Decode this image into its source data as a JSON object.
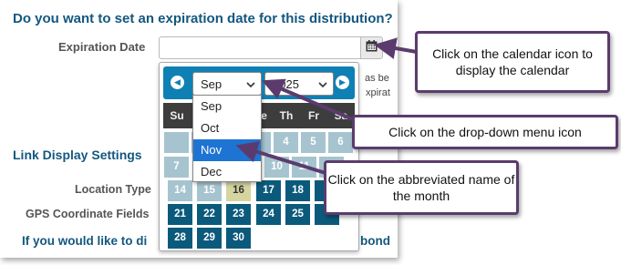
{
  "form": {
    "heading": "Do you want to set an expiration date for this distribution?",
    "expiration_label": "Expiration Date",
    "expiration_value": "",
    "behind_text_1": "as be",
    "behind_text_2": "xpirat",
    "section_title": "Link Display Settings",
    "location_type_label": "Location Type",
    "gps_label": "GPS Coordinate Fields",
    "bottom_text_left": "If you would like to di",
    "bottom_text_right": "bond"
  },
  "datepicker": {
    "month_selected": "Sep",
    "year_selected": "2025",
    "prev_icon": "chevron-left-icon",
    "next_icon": "chevron-right-icon",
    "weekdays": [
      "Su",
      "Mo",
      "Tu",
      "We",
      "Th",
      "Fr",
      "Sa"
    ],
    "row2_days": [
      "7",
      "",
      "",
      "10",
      "11",
      "12",
      ""
    ],
    "row1_days": [
      "",
      "",
      "",
      "3",
      "4",
      "5",
      "6"
    ],
    "row3_days": [
      "14",
      "15",
      "16",
      "17",
      "18",
      "",
      ""
    ],
    "row4_days": [
      "21",
      "22",
      "23",
      "24",
      "25",
      "",
      ""
    ],
    "row5_days": [
      "28",
      "29",
      "30"
    ],
    "today": "16"
  },
  "month_dropdown": {
    "options": [
      "Sep",
      "Oct",
      "Nov",
      "Dec"
    ],
    "highlighted": "Nov"
  },
  "callouts": {
    "calendar_icon": "Click on the calendar icon to display the calendar",
    "dropdown_icon": "Click on the drop-down menu icon",
    "month_name": "Click on the abbreviated name of the month"
  },
  "colors": {
    "heading_blue": "#13577f",
    "picker_header": "#0f80b4",
    "day_dark": "#0b5a7c",
    "day_muted": "#a6c4cf",
    "callout_border": "#5b3b6e",
    "highlight": "#1e74d2"
  }
}
